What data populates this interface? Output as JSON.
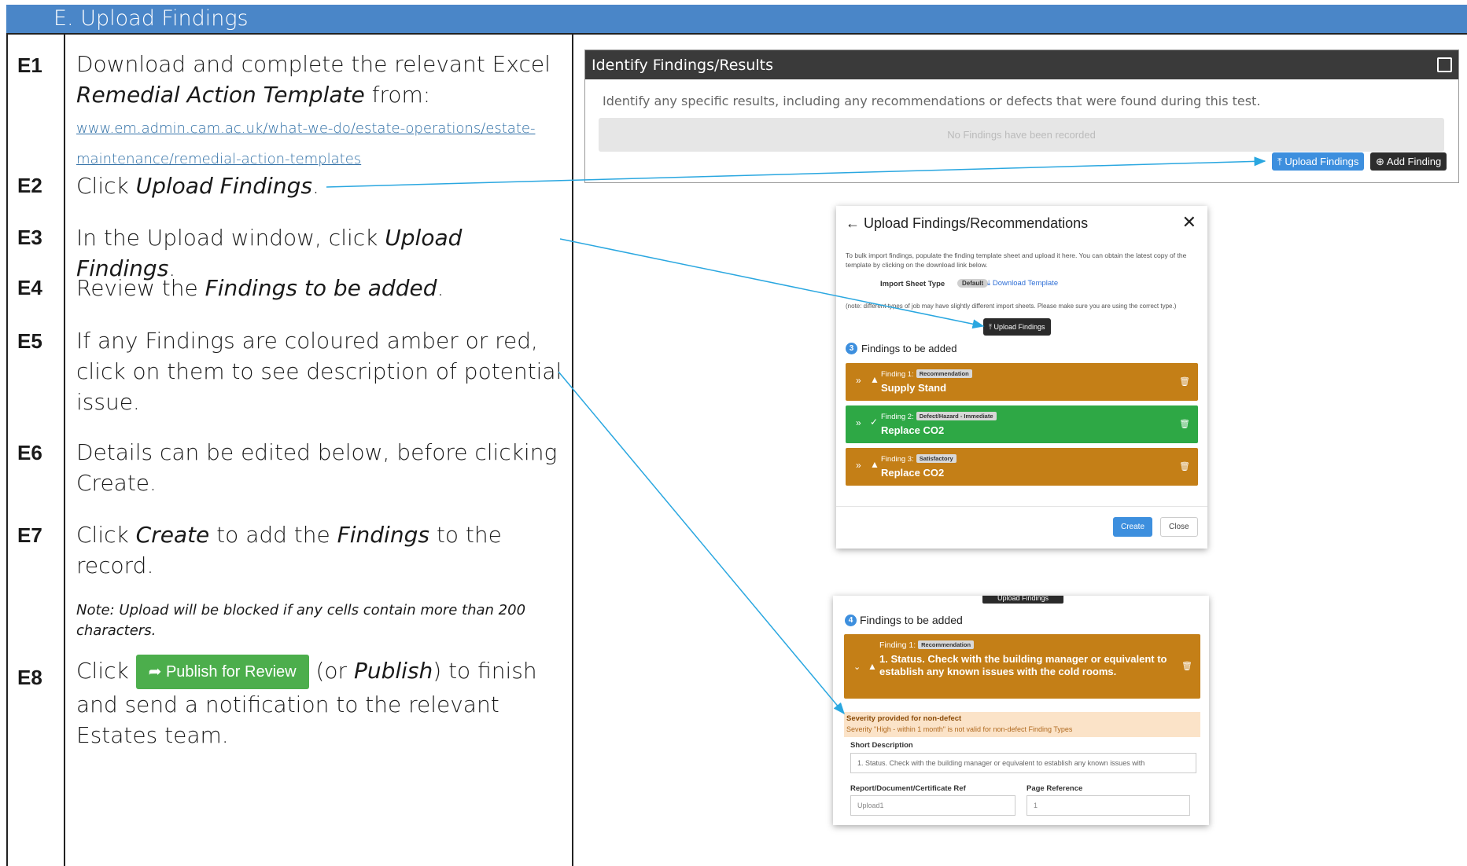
{
  "section": {
    "title": "E.  Upload Findings"
  },
  "steps": [
    {
      "num": "E1",
      "text_a": "Download and complete the relevant Excel ",
      "text_b_italic": "Remedial Action Template",
      "text_c": " from:",
      "link_line1": "www.em.admin.cam.ac.uk/what-we-do/estate-operations/estate-",
      "link_line2": "maintenance/remedial-action-templates"
    },
    {
      "num": "E2",
      "text_a": "Click ",
      "text_b_italic": "Upload Findings",
      "text_c": "."
    },
    {
      "num": "E3",
      "text_a": "In the Upload window, click ",
      "text_b_italic": "Upload Findings",
      "text_c": "."
    },
    {
      "num": "E4",
      "text_a": "Review the ",
      "text_b_italic": "Findings to be added",
      "text_c": "."
    },
    {
      "num": "E5",
      "text": "If any Findings are coloured amber or red, click on them to see description of potential issue."
    },
    {
      "num": "E6",
      "text": "Details can be edited below, before clicking Create."
    },
    {
      "num": "E7",
      "text_a": "Click ",
      "text_b_italic": "Create",
      "text_c": " to add the ",
      "text_d_italic": "Findings",
      "text_e": " to the record.",
      "note": "Note: Upload will be blocked if any cells contain more than 200 characters."
    },
    {
      "num": "E8",
      "text_a": "Click ",
      "button_label": "Publish for Review",
      "text_b": " (or ",
      "text_c_italic": "Publish",
      "text_d": ") to finish and send a notification to the relevant Estates team."
    }
  ],
  "panel1": {
    "title": "Identify Findings/Results",
    "description": "Identify any specific results, including any recommendations or defects that were found during this test.",
    "empty_text": "No Findings have been recorded",
    "upload_label": "Upload Findings",
    "add_label": "Add Finding"
  },
  "modal1": {
    "title": "Upload Findings/Recommendations",
    "description": "To bulk import findings, populate the finding template sheet and upload it here. You can obtain the latest copy of the template by clicking on the download link below.",
    "import_label": "Import Sheet Type",
    "default_badge": "Default",
    "download_label": "Download Template",
    "note": "(note: different types of job may have slightly different import sheets. Please make sure you are using the correct type.)",
    "upload_label": "Upload Findings",
    "count": "3",
    "count_label": "Findings to be added",
    "findings": [
      {
        "label": "Finding 1:",
        "badge": "Recommendation",
        "name": "Supply Stand",
        "status": "amber"
      },
      {
        "label": "Finding 2:",
        "badge": "Defect/Hazard - Immediate",
        "name": "Replace CO2",
        "status": "green"
      },
      {
        "label": "Finding 3:",
        "badge": "Satisfactory",
        "name": "Replace CO2",
        "status": "amber"
      }
    ],
    "create_label": "Create",
    "close_label": "Close"
  },
  "modal2": {
    "cut_label": "Upload Findings",
    "count": "4",
    "count_label": "Findings to be added",
    "finding_label": "Finding 1:",
    "finding_badge": "Recommendation",
    "finding_name": "1. Status. Check with the building manager or equivalent to establish any known issues with the cold rooms.",
    "warning_title": "Severity provided for non-defect",
    "warning_text": "Severity \"High - within 1 month\" is not valid for non-defect Finding Types",
    "short_label": "Short Description",
    "short_value": "1. Status. Check with the building manager or equivalent to establish any known issues with",
    "ref_label": "Report/Document/Certificate Ref",
    "ref_value": "Upload1",
    "page_label": "Page Reference",
    "page_value": "1"
  },
  "colors": {
    "header": "#4a86c8",
    "amber": "#c47f17",
    "green": "#2ea845",
    "publish": "#4cae4c",
    "line": "#2aa7e0"
  }
}
